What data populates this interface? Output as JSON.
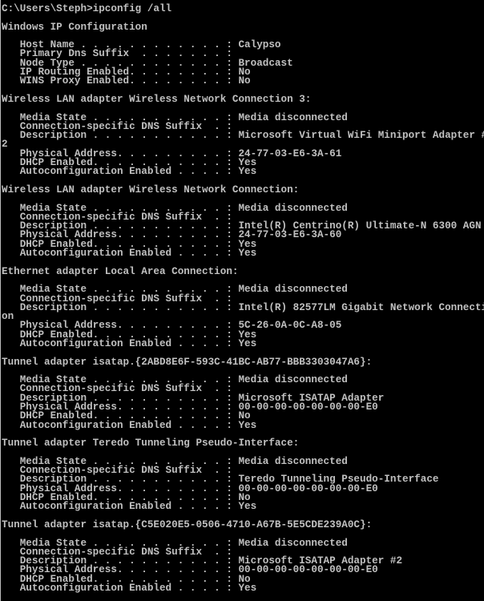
{
  "console": {
    "text_color": "#c0c0c0",
    "background_color": "#000000",
    "lines": [
      "C:\\Users\\Steph>ipconfig /all",
      "",
      "Windows IP Configuration",
      "",
      "   Host Name . . . . . . . . . . . . : Calypso",
      "   Primary Dns Suffix  . . . . . . . : ",
      "   Node Type . . . . . . . . . . . . : Broadcast",
      "   IP Routing Enabled. . . . . . . . : No",
      "   WINS Proxy Enabled. . . . . . . . : No",
      "",
      "Wireless LAN adapter Wireless Network Connection 3:",
      "",
      "   Media State . . . . . . . . . . . : Media disconnected",
      "   Connection-specific DNS Suffix  . : ",
      "   Description . . . . . . . . . . . : Microsoft Virtual WiFi Miniport Adapter #",
      "2",
      "   Physical Address. . . . . . . . . : 24-77-03-E6-3A-61",
      "   DHCP Enabled. . . . . . . . . . . : Yes",
      "   Autoconfiguration Enabled . . . . : Yes",
      "",
      "Wireless LAN adapter Wireless Network Connection:",
      "",
      "   Media State . . . . . . . . . . . : Media disconnected",
      "   Connection-specific DNS Suffix  . : ",
      "   Description . . . . . . . . . . . : Intel(R) Centrino(R) Ultimate-N 6300 AGN",
      "   Physical Address. . . . . . . . . : 24-77-03-E6-3A-60",
      "   DHCP Enabled. . . . . . . . . . . : Yes",
      "   Autoconfiguration Enabled . . . . : Yes",
      "",
      "Ethernet adapter Local Area Connection:",
      "",
      "   Media State . . . . . . . . . . . : Media disconnected",
      "   Connection-specific DNS Suffix  . : ",
      "   Description . . . . . . . . . . . : Intel(R) 82577LM Gigabit Network Connecti",
      "on",
      "   Physical Address. . . . . . . . . : 5C-26-0A-0C-A8-05",
      "   DHCP Enabled. . . . . . . . . . . : Yes",
      "   Autoconfiguration Enabled . . . . : Yes",
      "",
      "Tunnel adapter isatap.{2ABD8E6F-593C-41BC-AB77-BBB3303047A6}:",
      "",
      "   Media State . . . . . . . . . . . : Media disconnected",
      "   Connection-specific DNS Suffix  . : ",
      "   Description . . . . . . . . . . . : Microsoft ISATAP Adapter",
      "   Physical Address. . . . . . . . . : 00-00-00-00-00-00-00-E0",
      "   DHCP Enabled. . . . . . . . . . . : No",
      "   Autoconfiguration Enabled . . . . : Yes",
      "",
      "Tunnel adapter Teredo Tunneling Pseudo-Interface:",
      "",
      "   Media State . . . . . . . . . . . : Media disconnected",
      "   Connection-specific DNS Suffix  . : ",
      "   Description . . . . . . . . . . . : Teredo Tunneling Pseudo-Interface",
      "   Physical Address. . . . . . . . . : 00-00-00-00-00-00-00-E0",
      "   DHCP Enabled. . . . . . . . . . . : No",
      "   Autoconfiguration Enabled . . . . : Yes",
      "",
      "Tunnel adapter isatap.{C5E020E5-0506-4710-A67B-5E5CDE239A0C}:",
      "",
      "   Media State . . . . . . . . . . . : Media disconnected",
      "   Connection-specific DNS Suffix  . : ",
      "   Description . . . . . . . . . . . : Microsoft ISATAP Adapter #2",
      "   Physical Address. . . . . . . . . : 00-00-00-00-00-00-00-E0",
      "   DHCP Enabled. . . . . . . . . . . : No",
      "   Autoconfiguration Enabled . . . . : Yes"
    ]
  }
}
